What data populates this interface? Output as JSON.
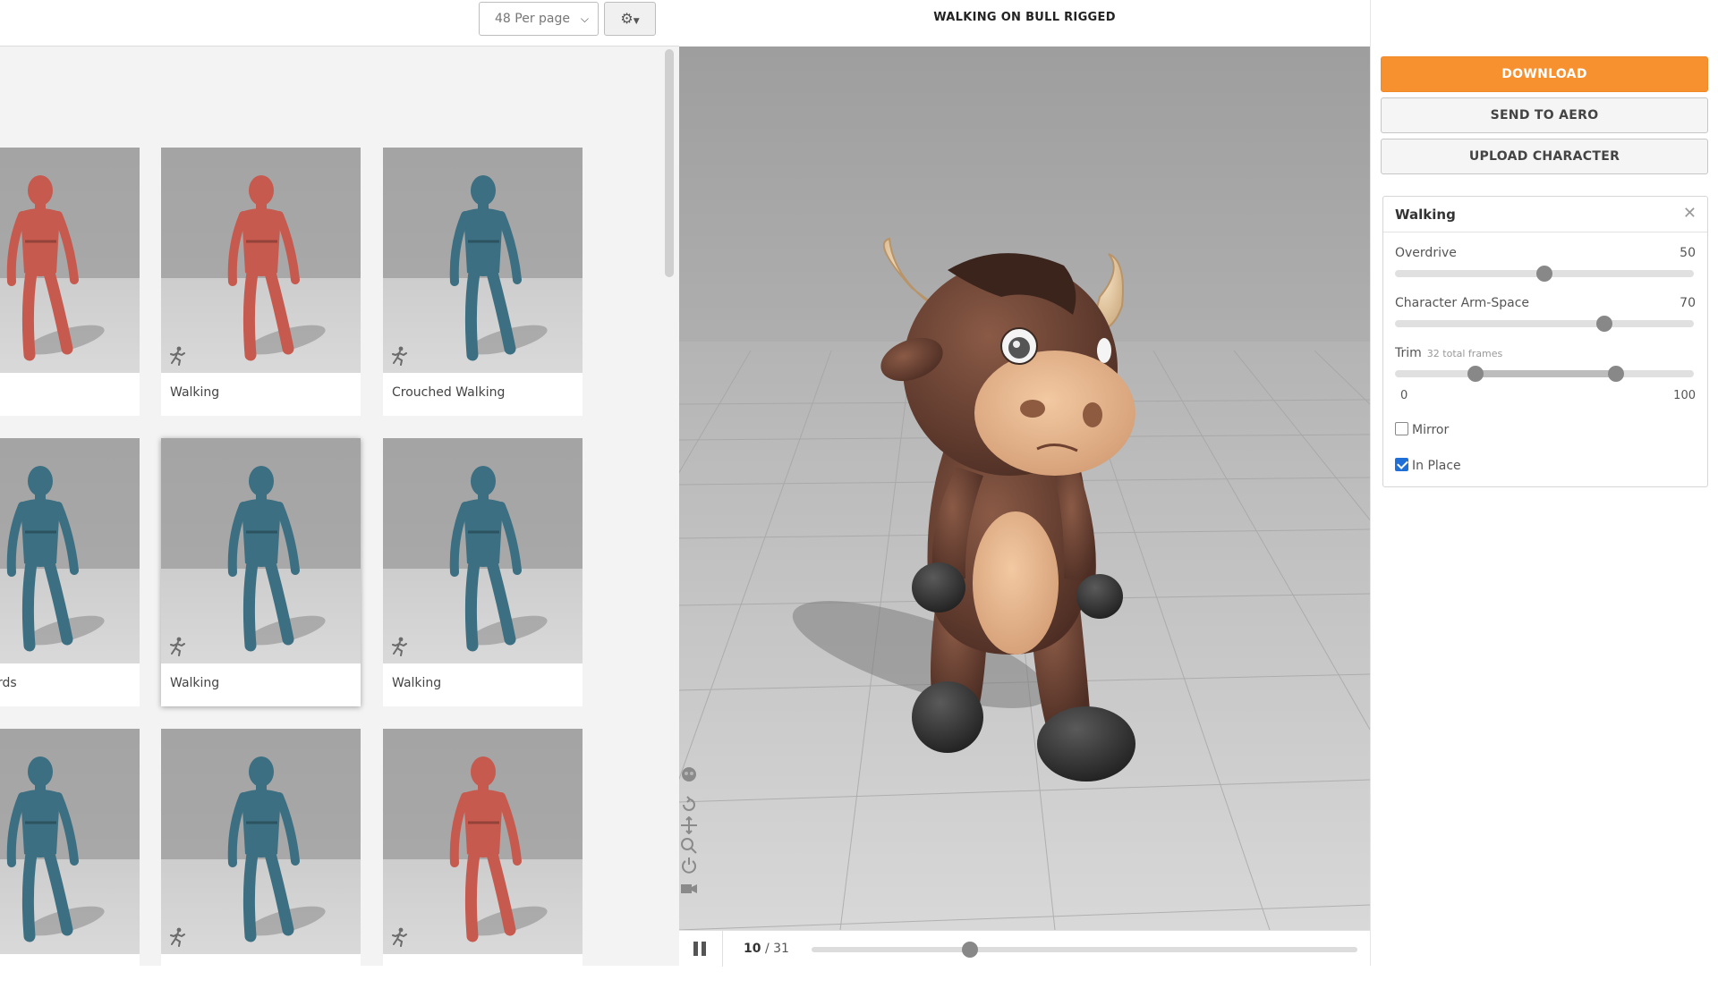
{
  "toolbar": {
    "per_page": "48 Per page",
    "settings_icon": "gear-icon"
  },
  "animation_cards": [
    {
      "label": "",
      "figure_color": "#c65a4e"
    },
    {
      "label": "Walking",
      "figure_color": "#c65a4e"
    },
    {
      "label": "Crouched Walking",
      "figure_color": "#3c6f82"
    },
    {
      "label": "Backwards",
      "figure_color": "#3c6f82"
    },
    {
      "label": "Walking",
      "figure_color": "#3c6f82",
      "selected": true
    },
    {
      "label": "Walking",
      "figure_color": "#3c6f82"
    },
    {
      "label": "",
      "figure_color": "#3c6f82"
    },
    {
      "label": "",
      "figure_color": "#3c6f82"
    },
    {
      "label": "",
      "figure_color": "#c65a4e"
    }
  ],
  "viewer": {
    "title": "WALKING ON BULL RIGGED",
    "tools": [
      "skeleton-icon",
      "rotate-icon",
      "pan-icon",
      "zoom-icon",
      "power-icon",
      "camera-icon"
    ]
  },
  "player": {
    "current_frame": "10",
    "total_frames": "/ 31",
    "progress": 0.29
  },
  "actions": {
    "download": "DOWNLOAD",
    "send_to_aero": "SEND TO AERO",
    "upload_character": "UPLOAD CHARACTER"
  },
  "settings": {
    "title": "Walking",
    "overdrive": {
      "label": "Overdrive",
      "value": "50",
      "level": 0.5
    },
    "arm_space": {
      "label": "Character Arm-Space",
      "value": "70",
      "level": 0.7
    },
    "trim": {
      "label": "Trim",
      "note": "32 total frames",
      "min_label": "0",
      "max_label": "100",
      "start": 0.27,
      "end": 0.74
    },
    "mirror": {
      "label": "Mirror",
      "checked": false
    },
    "in_place": {
      "label": "In Place",
      "checked": true
    }
  },
  "colors": {
    "accent": "#f7902e",
    "checkbox_checked": "#1f6fd6"
  }
}
